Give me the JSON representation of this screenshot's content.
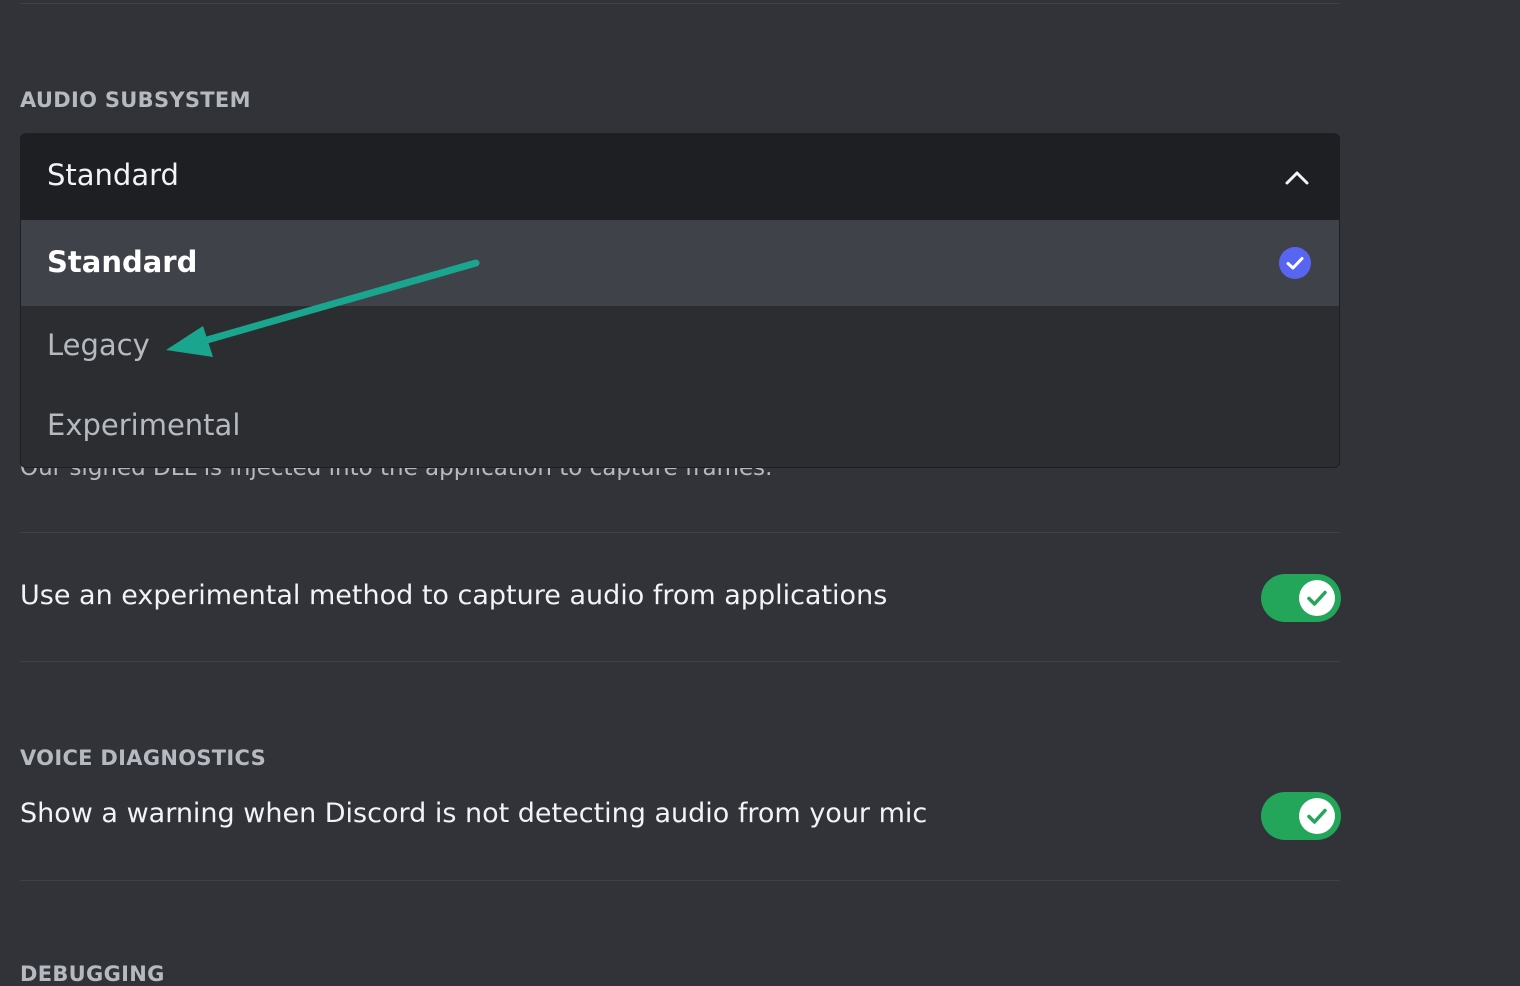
{
  "colors": {
    "background": "#313338",
    "dropdown_header": "#1e1f22",
    "dropdown_menu": "#2b2d31",
    "selected_option": "#404249",
    "toggle_on": "#23a55a",
    "check_accent": "#5865f2",
    "annotation_arrow": "#1aa68e"
  },
  "audio_subsystem": {
    "title": "AUDIO SUBSYSTEM",
    "selected_value": "Standard",
    "chevron_icon": "chevron-up-icon",
    "options": [
      {
        "label": "Standard",
        "selected": true
      },
      {
        "label": "Legacy",
        "selected": false
      },
      {
        "label": "Experimental",
        "selected": false
      }
    ]
  },
  "capture": {
    "partial_description": "Our signed DLL is injected into the application to capture frames.",
    "experimental_audio_label": "Use an experimental method to capture audio from applications",
    "experimental_audio_enabled": true
  },
  "voice_diagnostics": {
    "title": "VOICE DIAGNOSTICS",
    "mic_warning_label": "Show a warning when Discord is not detecting audio from your mic",
    "mic_warning_enabled": true
  },
  "debugging": {
    "title": "DEBUGGING"
  }
}
